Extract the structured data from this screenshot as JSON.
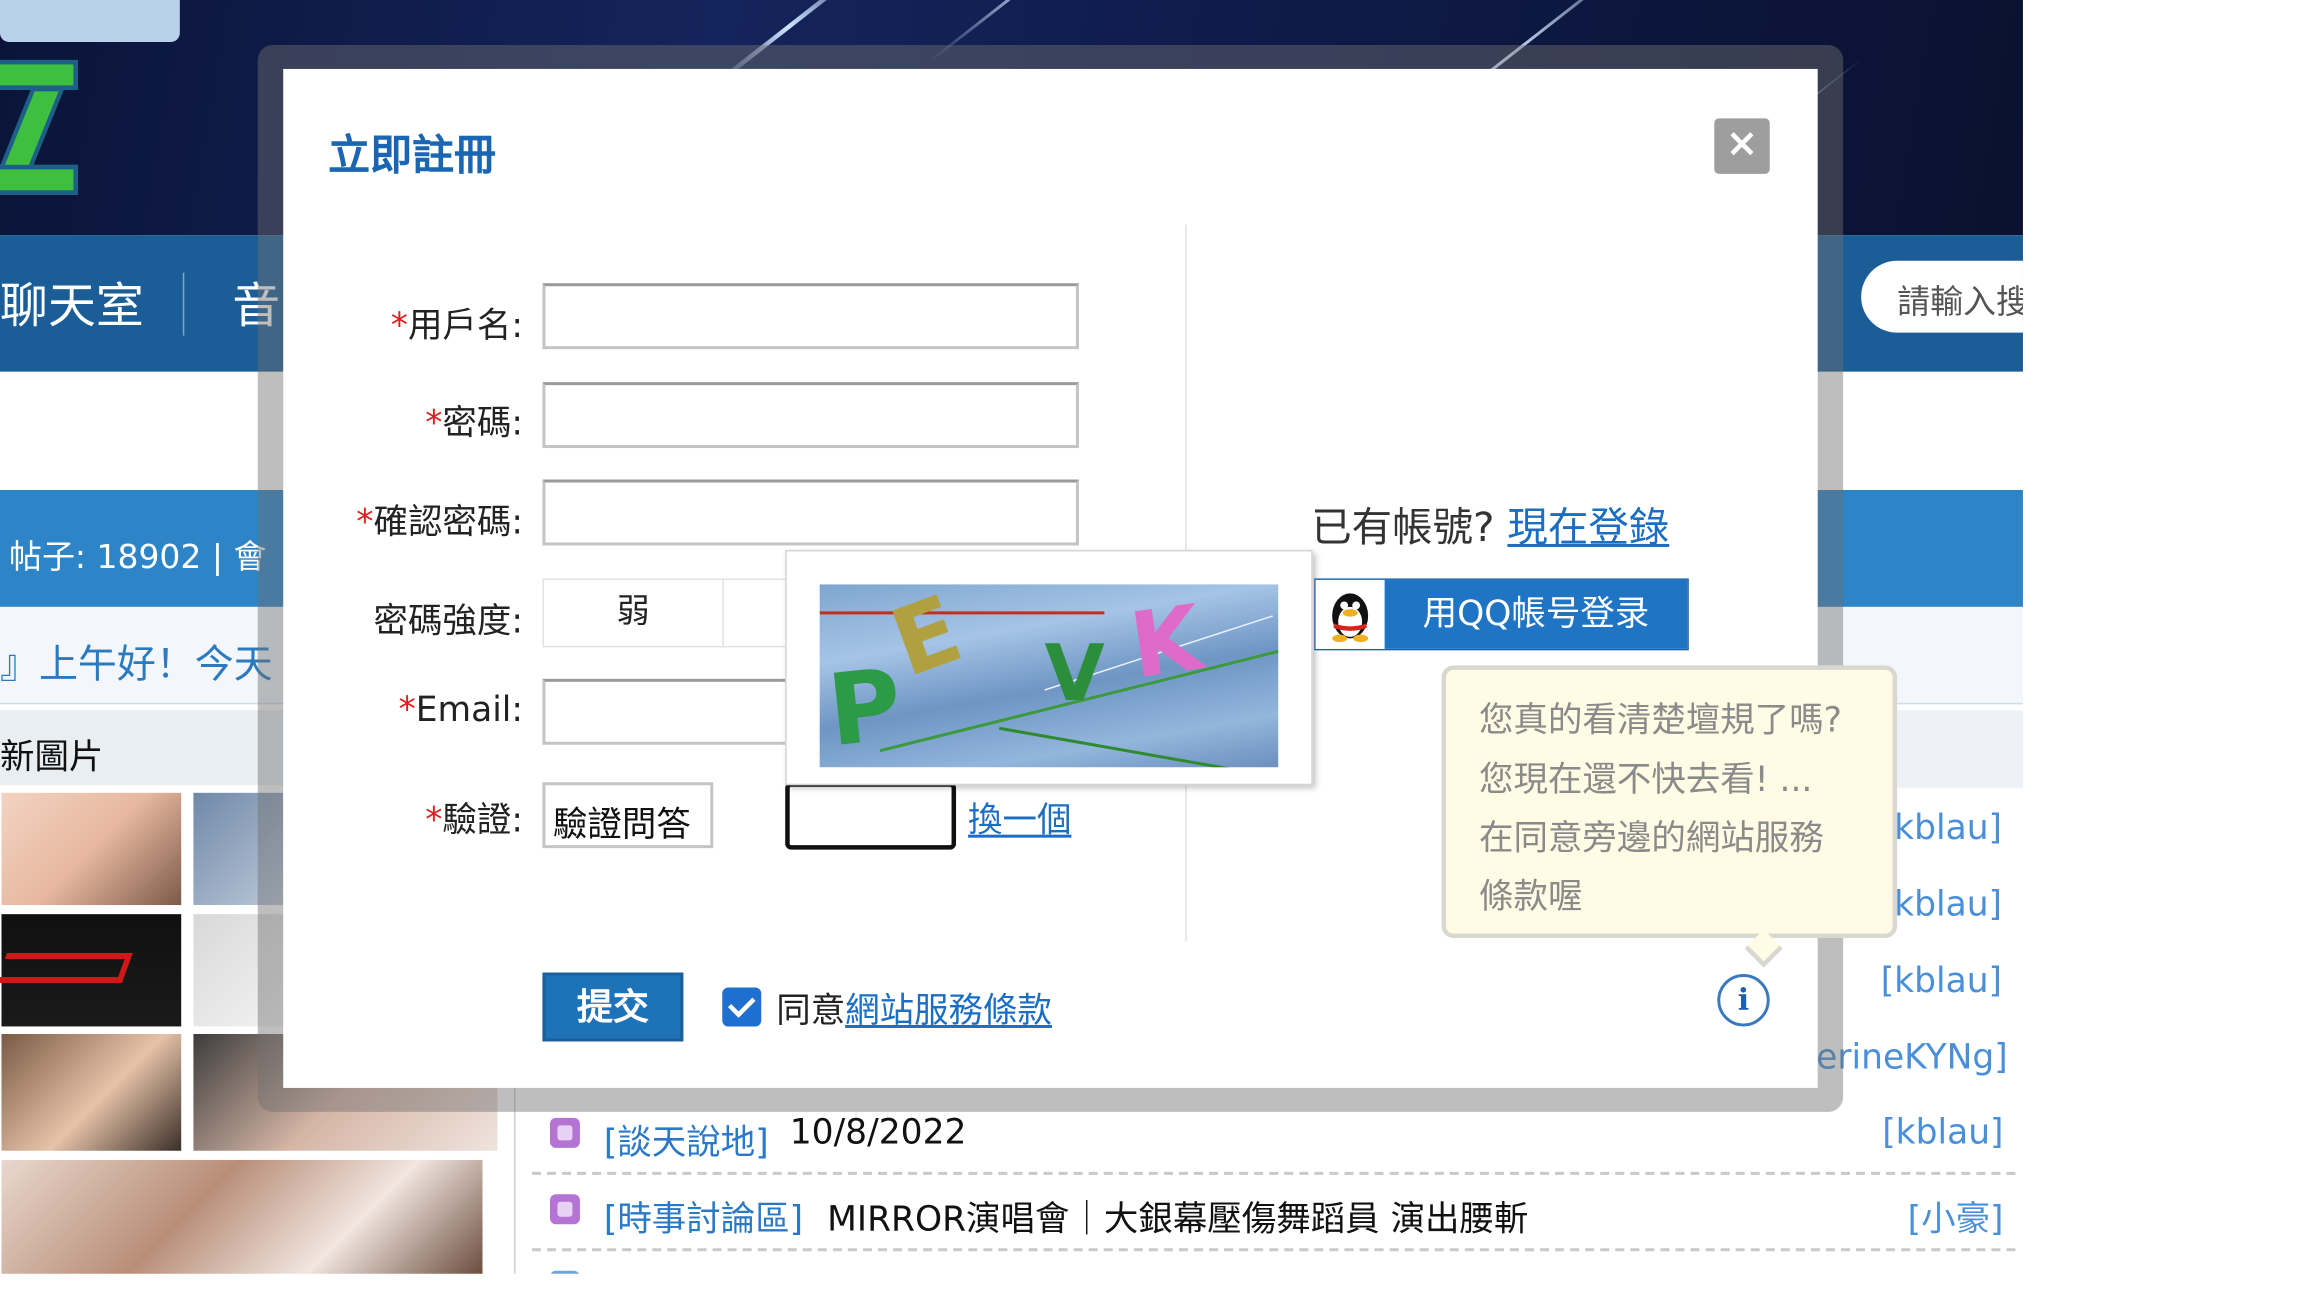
{
  "background": {
    "nav_items": [
      "聊天室",
      "音"
    ],
    "search_placeholder": "請輸入搜",
    "stats_text": "帖子: 18902 | 會",
    "greeting": "』上午好！今天",
    "new_images_label": "新圖片",
    "right_users": [
      "[kblau]",
      "[kblau]",
      "[kblau]",
      "erineKYNg]"
    ],
    "list_rows": [
      {
        "forum": "[談天說地]",
        "title": "10/8/2022",
        "user": "[kblau]"
      },
      {
        "forum": "[時事討論區]",
        "title": "MIRROR演唱會｜大銀幕壓傷舞蹈員 演出腰斬",
        "user": "[小豪]"
      }
    ]
  },
  "dialog": {
    "title": "立即註冊",
    "close_symbol": "×",
    "fields": {
      "username_label": "用戶名:",
      "password_label": "密碼:",
      "confirm_label": "確認密碼:",
      "strength_label": "密碼強度:",
      "strength_value": "弱",
      "email_label": "Email:",
      "verify_label": "驗證:",
      "required_mark": "*"
    },
    "verify_question": "驗證問答",
    "swap_link": "換一個",
    "captcha_text": "PEVK",
    "submit_label": "提交",
    "agree_prefix": "同意",
    "agree_link": "網站服務條款",
    "have_account": "已有帳號?",
    "login_link": "現在登錄",
    "qq_login": "用QQ帳号登录",
    "tooltip_lines": [
      "您真的看清楚壇規了嗎?",
      "您現在還不快去看! ...",
      "在同意旁邊的網站服務",
      "條款喔"
    ],
    "info_symbol": "i"
  },
  "colors": {
    "dialog_title": "#1b66b3",
    "nav_bg": "#1a5d97",
    "submit_bg": "#1e73b8",
    "link": "#1b6ec2",
    "required": "#e02020"
  }
}
